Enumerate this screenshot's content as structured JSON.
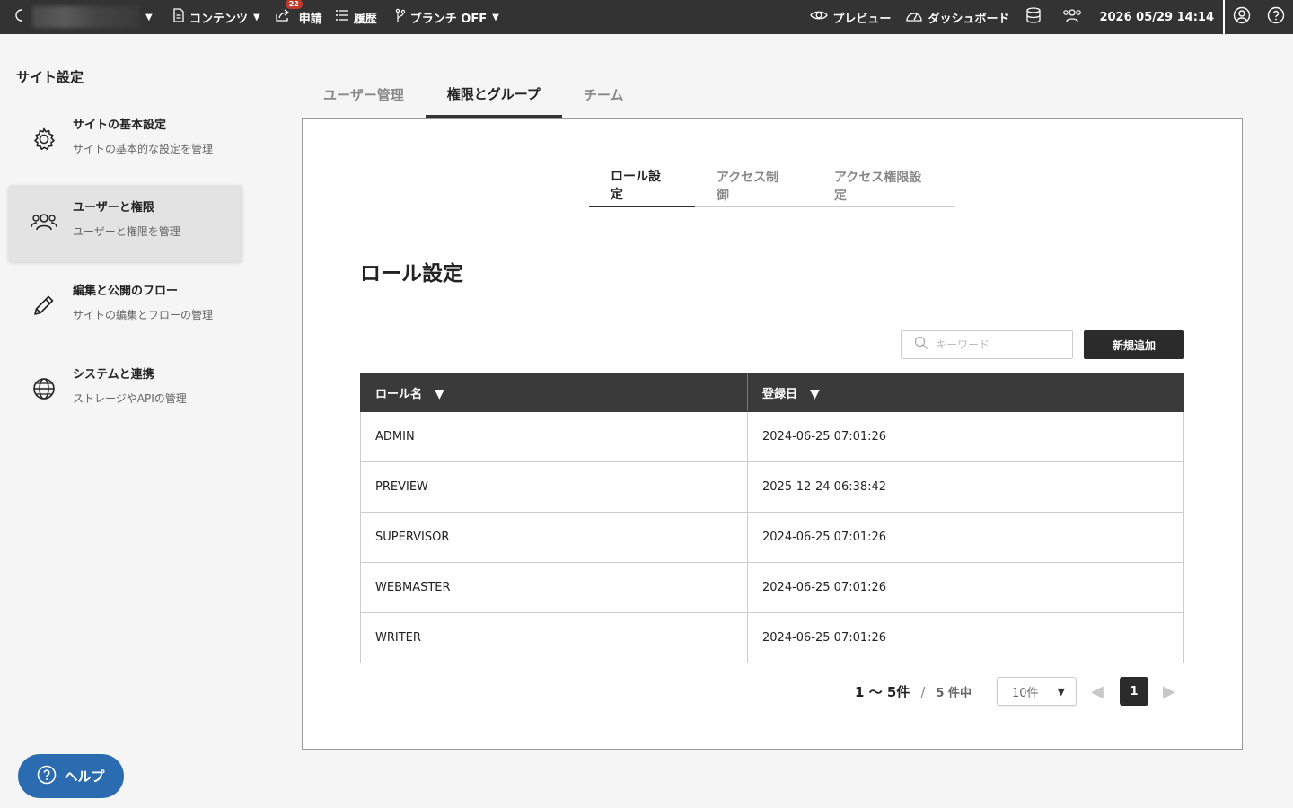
{
  "topbar": {
    "contents_label": "コンテンツ",
    "requests_label": "申請",
    "requests_badge": "22",
    "history_label": "履歴",
    "branch_label": "ブランチ OFF",
    "preview_label": "プレビュー",
    "dashboard_label": "ダッシュボード",
    "datetime": "2026 05/29 14:14"
  },
  "sidebar": {
    "title": "サイト設定",
    "items": [
      {
        "name": "サイトの基本設定",
        "desc": "サイトの基本的な設定を管理"
      },
      {
        "name": "ユーザーと権限",
        "desc": "ユーザーと権限を管理"
      },
      {
        "name": "編集と公開のフロー",
        "desc": "サイトの編集とフローの管理"
      },
      {
        "name": "システムと連携",
        "desc": "ストレージやAPIの管理"
      }
    ]
  },
  "tabs": [
    "ユーザー管理",
    "権限とグループ",
    "チーム"
  ],
  "subtabs": [
    "ロール設定",
    "アクセス制御",
    "アクセス権限設定"
  ],
  "main": {
    "title": "ロール設定",
    "search_placeholder": "キーワード",
    "add_button": "新規追加"
  },
  "table": {
    "headers": [
      "ロール名",
      "登録日"
    ],
    "sort_glyph": "▼",
    "rows": [
      [
        "ADMIN",
        "2024-06-25 07:01:26"
      ],
      [
        "PREVIEW",
        "2025-12-24 06:38:42"
      ],
      [
        "SUPERVISOR",
        "2024-06-25 07:01:26"
      ],
      [
        "WEBMASTER",
        "2024-06-25 07:01:26"
      ],
      [
        "WRITER",
        "2024-06-25 07:01:26"
      ]
    ]
  },
  "pager": {
    "range": "1 〜 5件",
    "slash": "/",
    "total": "5 件中",
    "per_page": "10件",
    "current_page": "1"
  },
  "help": {
    "label": "ヘルプ"
  },
  "colors": {
    "topbar": "#333333",
    "accent_dark": "#2b2b2b",
    "help_button": "#2b6cb0",
    "badge": "#c0392b"
  }
}
